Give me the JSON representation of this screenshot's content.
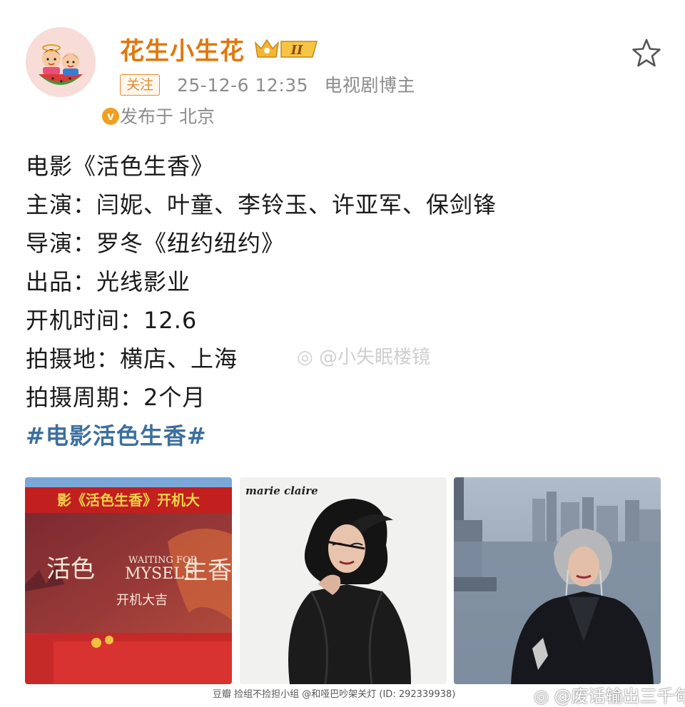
{
  "header": {
    "username": "花生小生花",
    "level_badge": "II",
    "follow_label": "关注",
    "timestamp": "25-12-6 12:35",
    "author_tag": "电视剧博主",
    "location": "发布于 北京",
    "verified_mark": "v"
  },
  "post": {
    "lines": [
      "电影《活色生香》",
      "主演：闫妮、叶童、李铃玉、许亚军、保剑锋",
      "导演：罗冬《纽约纽约》",
      "出品：光线影业",
      "开机时间：12.6",
      "拍摄地：横店、上海",
      "拍摄周期：2个月"
    ],
    "hashtag": "#电影活色生香#"
  },
  "watermarks": {
    "mid": "@小失眠楼镜",
    "bottom": "@废话输出三千句",
    "credit": "豆瓣  捡组不捡担小组 @和哑巴吵架关灯 (ID: 292339938)"
  },
  "photos": {
    "photo1": {
      "banner": "影《活色生香》开机大",
      "title_left": "活色",
      "title_en_1": "WAITING FOR",
      "title_en_2": "MYSELF",
      "title_right": "生香",
      "subtitle": "开机大吉"
    },
    "photo2": {
      "magazine": "marie claire"
    }
  },
  "colors": {
    "username": "#e0780c",
    "hashtag": "#3d6f9e",
    "meta": "#8c8c8c",
    "banner_red": "#c21f1f"
  }
}
